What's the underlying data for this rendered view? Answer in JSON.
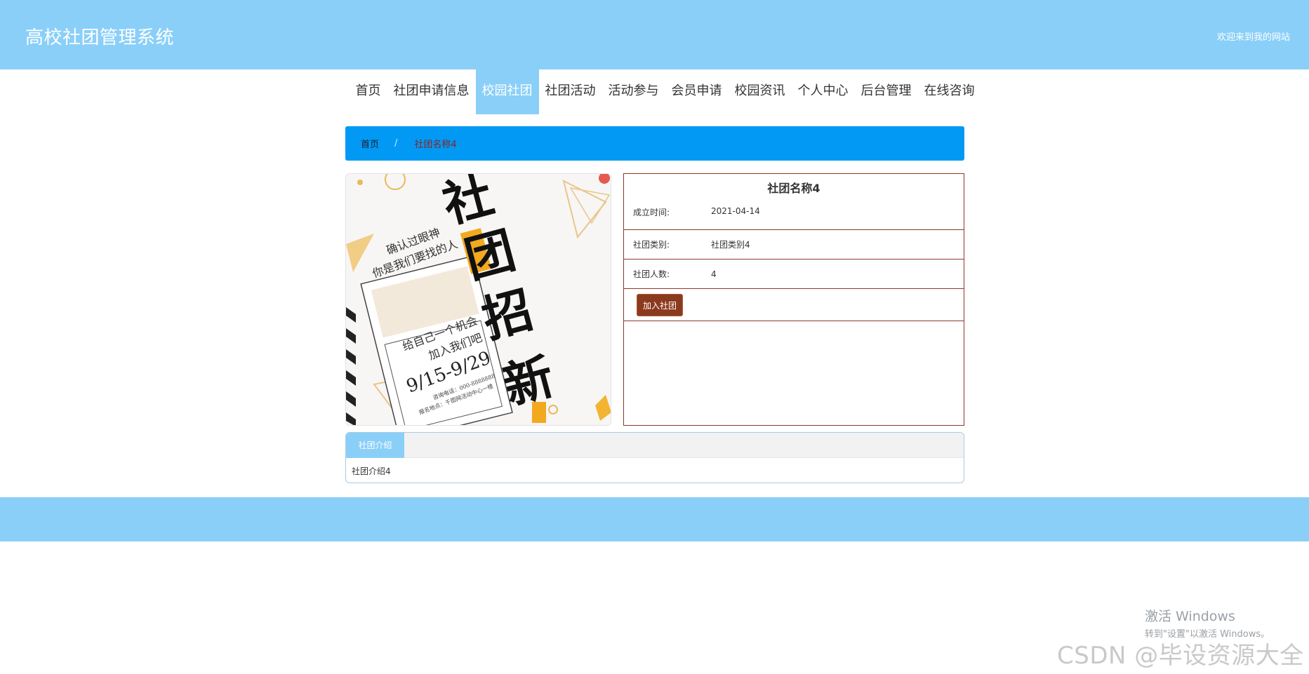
{
  "header": {
    "title": "高校社团管理系统",
    "welcome": "欢迎来到我的网站"
  },
  "nav": {
    "items": [
      {
        "label": "首页"
      },
      {
        "label": "社团申请信息"
      },
      {
        "label": "校园社团"
      },
      {
        "label": "社团活动"
      },
      {
        "label": "活动参与"
      },
      {
        "label": "会员申请"
      },
      {
        "label": "校园资讯"
      },
      {
        "label": "个人中心"
      },
      {
        "label": "后台管理"
      },
      {
        "label": "在线咨询"
      }
    ],
    "active_index": 2
  },
  "breadcrumb": {
    "home": "首页",
    "separator": "/",
    "current": "社团名称4"
  },
  "poster": {
    "big_chars": [
      "社",
      "团",
      "招",
      "新"
    ],
    "line1": "确认过眼神",
    "line2": "你是我们要找的人",
    "line3": "给自己一个机会",
    "line4": "加入我们吧",
    "dates": "9/15-9/29",
    "phone": "咨询电话：000-8888888",
    "address": "报名地点：千图网活动中心一楼"
  },
  "detail": {
    "title": "社团名称4",
    "fields": [
      {
        "label": "成立时间:",
        "value": "2021-04-14"
      },
      {
        "label": "社团类别:",
        "value": "社团类别4"
      },
      {
        "label": "社团人数:",
        "value": "4"
      }
    ],
    "join_label": "加入社团"
  },
  "intro": {
    "tab_label": "社团介绍",
    "content": "社团介绍4"
  },
  "watermark": {
    "windows_line1": "激活 Windows",
    "windows_line2": "转到\"设置\"以激活 Windows。",
    "csdn": "CSDN @毕设资源大全"
  },
  "colors": {
    "header_bg": "#8acff8",
    "breadcrumb_bg": "#0299f4",
    "accent_brown": "#8b3a1e",
    "detail_border": "#8b3a2a"
  }
}
